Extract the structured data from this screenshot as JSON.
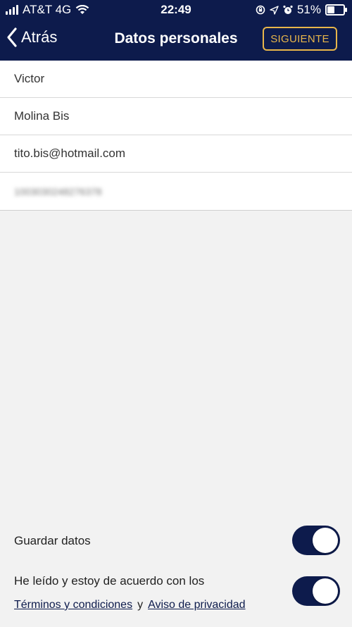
{
  "status_bar": {
    "carrier": "AT&T 4G",
    "time": "22:49",
    "battery_percent_text": "51%",
    "battery_level": 0.51
  },
  "nav": {
    "back_label": "Atrás",
    "title": "Datos personales",
    "next_label": "SIGUIENTE"
  },
  "form": {
    "first_name": "Victor",
    "last_name": "Molina Bis",
    "email": "tito.bis@hotmail.com",
    "phone": "1003030248276378"
  },
  "options": {
    "save_data_label": "Guardar datos",
    "save_data_on": true,
    "terms_text": "He leído y estoy de acuerdo con los",
    "terms_link": "Términos y condiciones",
    "conjunction": "y",
    "privacy_link": "Aviso de privacidad",
    "terms_on": true
  },
  "colors": {
    "primary": "#0d1b4c",
    "accent": "#e8b64a"
  }
}
